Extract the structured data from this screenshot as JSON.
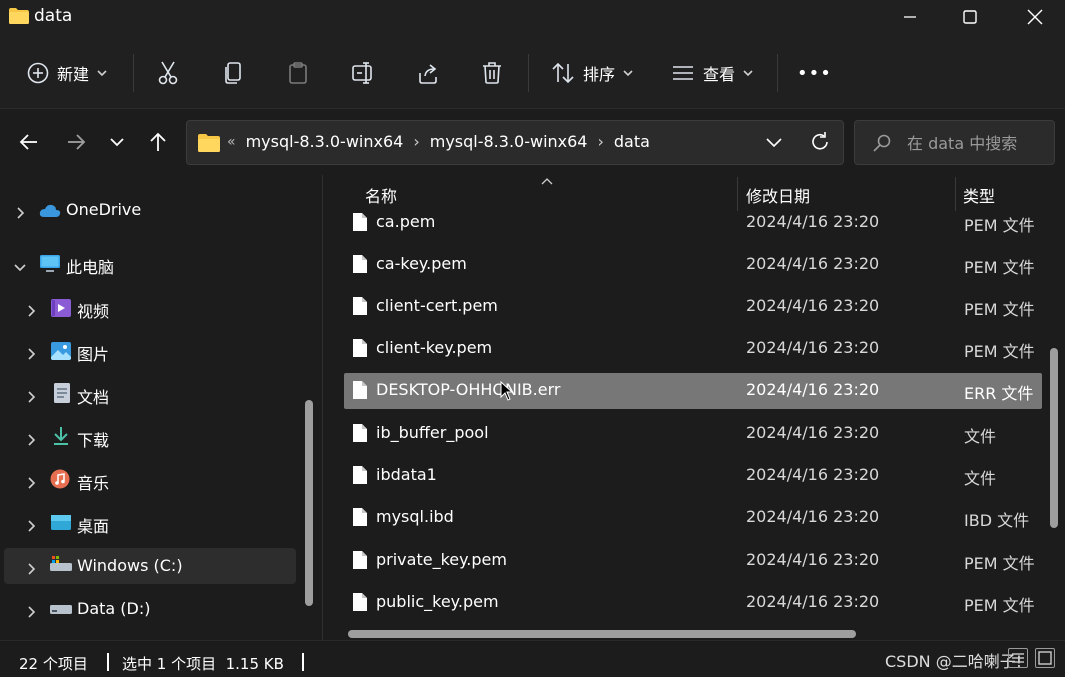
{
  "window": {
    "title": "data",
    "controls": {
      "minimize": "minimize",
      "maximize": "maximize",
      "close": "close"
    }
  },
  "toolbar": {
    "new_label": "新建",
    "sort_label": "排序",
    "view_label": "查看",
    "more_label": "•••"
  },
  "address": {
    "overflow": "«",
    "crumbs": [
      "mysql-8.3.0-winx64",
      "mysql-8.3.0-winx64",
      "data"
    ],
    "separator": "›"
  },
  "search": {
    "placeholder": "在 data 中搜索"
  },
  "sidebar": {
    "items": [
      {
        "label": "OneDrive",
        "expanded": false
      },
      {
        "label": "此电脑",
        "expanded": true
      },
      {
        "label": "视频",
        "expanded": false
      },
      {
        "label": "图片",
        "expanded": false
      },
      {
        "label": "文档",
        "expanded": false
      },
      {
        "label": "下载",
        "expanded": false
      },
      {
        "label": "音乐",
        "expanded": false
      },
      {
        "label": "桌面",
        "expanded": false
      },
      {
        "label": "Windows (C:)",
        "expanded": false,
        "selected": true
      },
      {
        "label": "Data (D:)",
        "expanded": false
      }
    ]
  },
  "columns": {
    "name": "名称",
    "date": "修改日期",
    "type": "类型"
  },
  "files": [
    {
      "name": "ca.pem",
      "date": "2024/4/16 23:20",
      "type": "PEM 文件"
    },
    {
      "name": "ca-key.pem",
      "date": "2024/4/16 23:20",
      "type": "PEM 文件"
    },
    {
      "name": "client-cert.pem",
      "date": "2024/4/16 23:20",
      "type": "PEM 文件"
    },
    {
      "name": "client-key.pem",
      "date": "2024/4/16 23:20",
      "type": "PEM 文件"
    },
    {
      "name": "DESKTOP-OHHONIB.err",
      "date": "2024/4/16 23:20",
      "type": "ERR 文件",
      "selected": true
    },
    {
      "name": "ib_buffer_pool",
      "date": "2024/4/16 23:20",
      "type": "文件"
    },
    {
      "name": "ibdata1",
      "date": "2024/4/16 23:20",
      "type": "文件"
    },
    {
      "name": "mysql.ibd",
      "date": "2024/4/16 23:20",
      "type": "IBD 文件"
    },
    {
      "name": "private_key.pem",
      "date": "2024/4/16 23:20",
      "type": "PEM 文件"
    },
    {
      "name": "public_key.pem",
      "date": "2024/4/16 23:20",
      "type": "PEM 文件"
    }
  ],
  "status": {
    "count": "22 个项目",
    "selection": "选中 1 个项目  1.15 KB"
  },
  "watermark": "CSDN @二哈喇子!",
  "colors": {
    "background": "#1c1c1c",
    "selected_row": "#777777",
    "folder": "#f6c744",
    "accent": "#4cc2ff"
  }
}
